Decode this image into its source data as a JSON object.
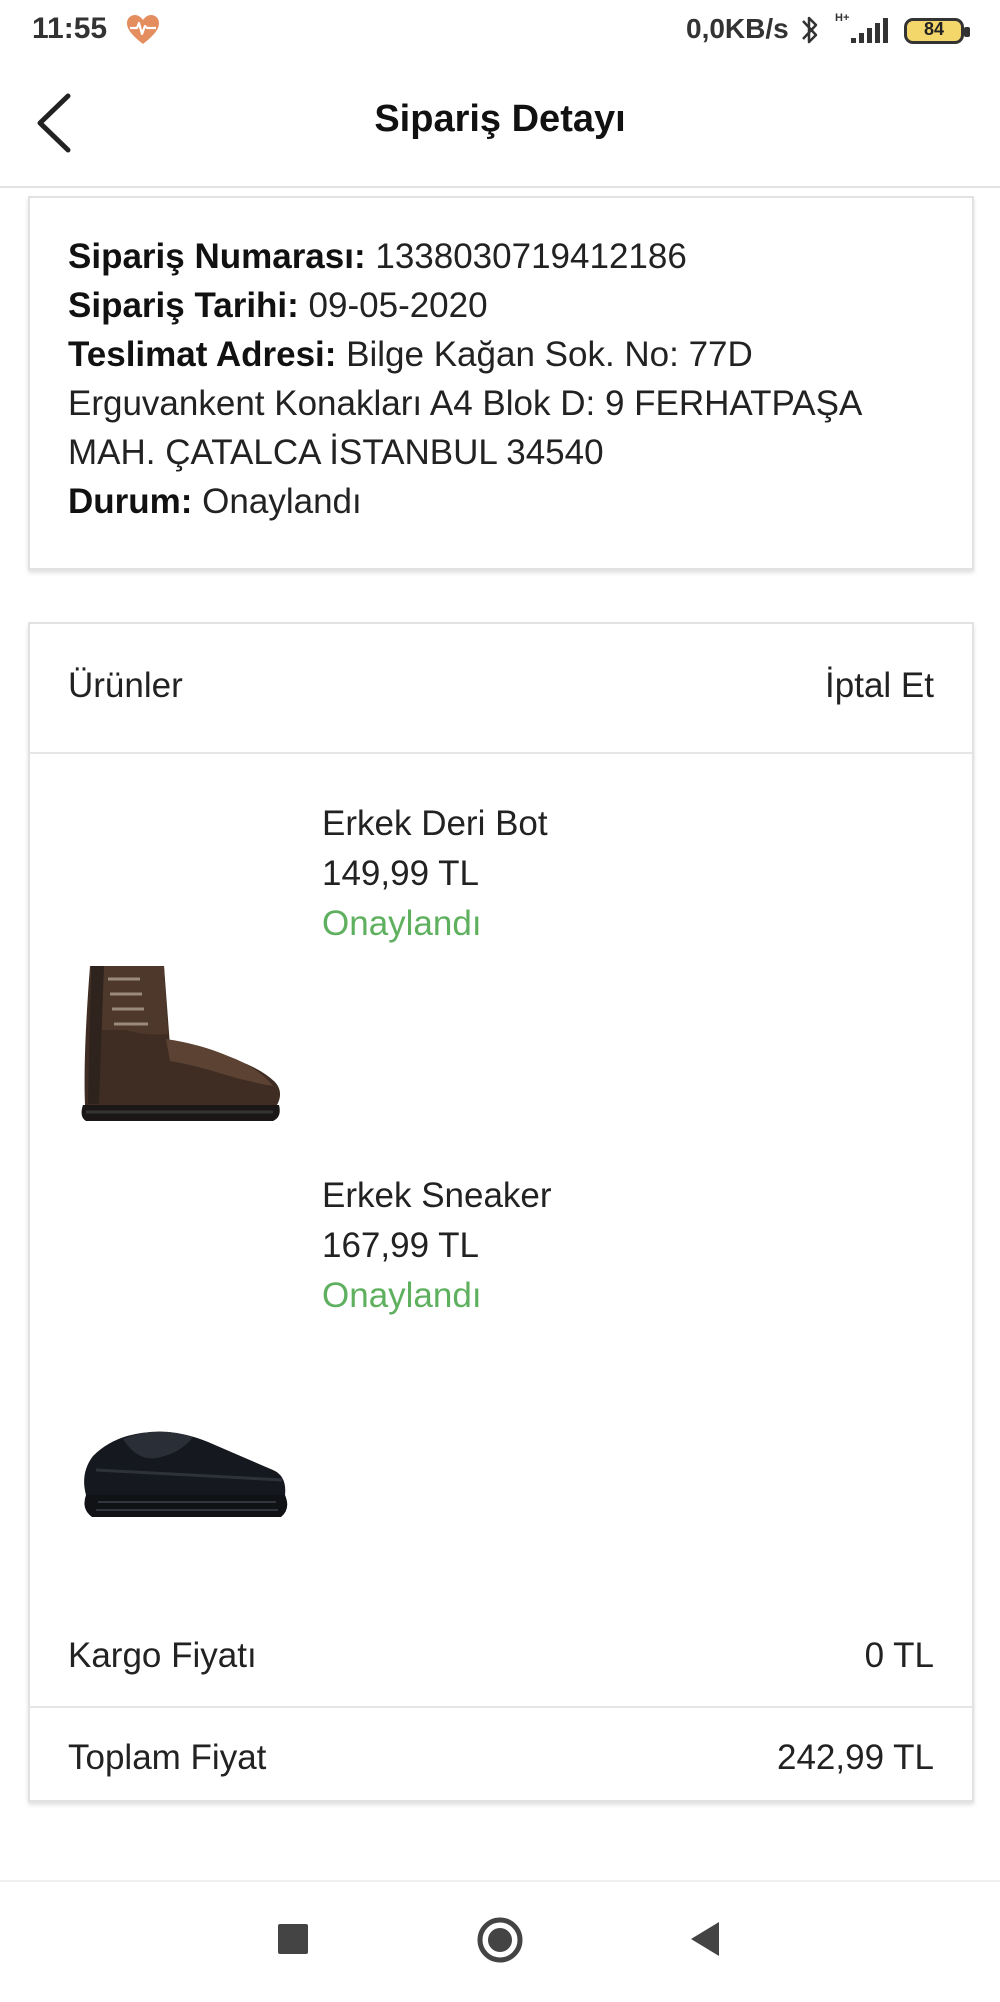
{
  "status_bar": {
    "time": "11:55",
    "speed": "0,0KB/s",
    "network": "H+",
    "battery": "84",
    "heart_icon": "heart-pulse-icon",
    "bluetooth_icon": "bluetooth-icon",
    "signal_icon": "signal-icon"
  },
  "header": {
    "title": "Sipariş Detayı",
    "back_icon": "chevron-left-icon"
  },
  "order": {
    "number_label": "Sipariş Numarası:",
    "number_value": "1338030719412186",
    "date_label": "Sipariş Tarihi:",
    "date_value": "09-05-2020",
    "address_label": "Teslimat Adresi:",
    "address_line_1": "Bilge Kağan Sok. No: 77D",
    "address_line_2": "Erguvankent Konakları A4 Blok D: 9 FERHATPAŞA",
    "address_line_3": "MAH. ÇATALCA İSTANBUL 34540",
    "status_label": "Durum:",
    "status_value": "Onaylandı"
  },
  "products": {
    "title": "Ürünler",
    "cancel_label": "İptal Et",
    "items": [
      {
        "name": "Erkek Deri Bot",
        "price": "149,99 TL",
        "status": "Onaylandı",
        "image": "leather-boot-image"
      },
      {
        "name": "Erkek Sneaker",
        "price": "167,99 TL",
        "status": "Onaylandı",
        "image": "black-sneaker-image"
      }
    ],
    "shipping_label": "Kargo Fiyatı",
    "shipping_value": "0 TL",
    "total_label": "Toplam Fiyat",
    "total_value": "242,99 TL"
  },
  "colors": {
    "accent_status": "#5eb05f",
    "card_border": "#e2e2e2",
    "battery_fill": "#f3d76a"
  },
  "nav_bar": {
    "recent_icon": "square-icon",
    "home_icon": "home-circle-icon",
    "back_icon": "triangle-back-icon"
  }
}
